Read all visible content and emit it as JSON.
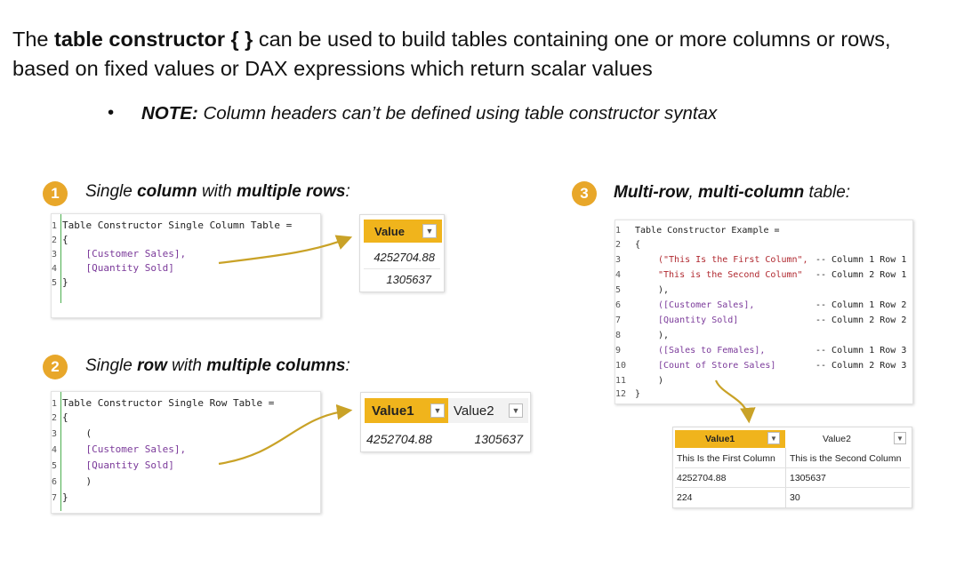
{
  "intro": {
    "part1": "The ",
    "bold": "table constructor { }",
    "part2": " can be used to build tables containing one or more columns or rows, based on fixed values or DAX expressions which return scalar values"
  },
  "note": {
    "bullet": "•",
    "label": "NOTE:",
    "text": " Column headers can’t be defined using table constructor syntax"
  },
  "section1": {
    "number": "1",
    "h1": "Single ",
    "h2": "column",
    "h3": " with ",
    "h4": "multiple rows",
    "h5": ":",
    "code": [
      {
        "n": "1",
        "t": "Table Constructor Single Column Table ="
      },
      {
        "n": "2",
        "t": "{"
      },
      {
        "n": "3",
        "t": "    [Customer Sales],"
      },
      {
        "n": "4",
        "t": "    [Quantity Sold]"
      },
      {
        "n": "5",
        "t": "}"
      }
    ],
    "table": {
      "header": "Value",
      "rows": [
        "4252704.88",
        "1305637"
      ]
    }
  },
  "section2": {
    "number": "2",
    "h1": "Single ",
    "h2": "row",
    "h3": " with ",
    "h4": "multiple columns",
    "h5": ":",
    "code": [
      {
        "n": "1",
        "t": "Table Constructor Single Row Table ="
      },
      {
        "n": "2",
        "t": "{"
      },
      {
        "n": "3",
        "t": "    ("
      },
      {
        "n": "4",
        "t": "    [Customer Sales],"
      },
      {
        "n": "5",
        "t": "    [Quantity Sold]"
      },
      {
        "n": "6",
        "t": "    )"
      },
      {
        "n": "7",
        "t": "}"
      }
    ],
    "table": {
      "headers": [
        "Value1",
        "Value2"
      ],
      "row": [
        "4252704.88",
        "1305637"
      ]
    }
  },
  "section3": {
    "number": "3",
    "h1": "Multi-row",
    "h2": ", ",
    "h3": "multi-column",
    "h4": " table:",
    "code": [
      {
        "n": "1",
        "t": "Table Constructor Example ="
      },
      {
        "n": "2",
        "t": "{"
      },
      {
        "n": "3",
        "t": "(\"This Is the First Column\",",
        "c": "-- Column 1 Row 1"
      },
      {
        "n": "4",
        "t": "\"This is the Second Column\"",
        "c": "-- Column 2 Row 1"
      },
      {
        "n": "5",
        "t": "),"
      },
      {
        "n": "6",
        "t": "([Customer Sales],",
        "c": "-- Column 1 Row 2"
      },
      {
        "n": "7",
        "t": "[Quantity Sold]",
        "c": "-- Column 2 Row 2"
      },
      {
        "n": "8",
        "t": "),"
      },
      {
        "n": "9",
        "t": "([Sales to Females],",
        "c": "-- Column 1 Row 3"
      },
      {
        "n": "10",
        "t": "[Count of Store Sales]",
        "c": "-- Column 2 Row 3"
      },
      {
        "n": "11",
        "t": ")"
      },
      {
        "n": "12",
        "t": "}"
      }
    ],
    "table": {
      "headers": [
        "Value1",
        "Value2"
      ],
      "rows": [
        [
          "This Is the First Column",
          "This is the Second Column"
        ],
        [
          "4252704.88",
          "1305637"
        ],
        [
          "224",
          "30"
        ]
      ]
    }
  },
  "colors": {
    "accent": "#e8a72a",
    "header": "#f0b41c",
    "arrow": "#c9a227",
    "measure": "#7b3a9a",
    "string": "#b0282f",
    "comment": "#2f8a2f"
  },
  "icons": {
    "dropdown": "chevron-down-icon"
  }
}
